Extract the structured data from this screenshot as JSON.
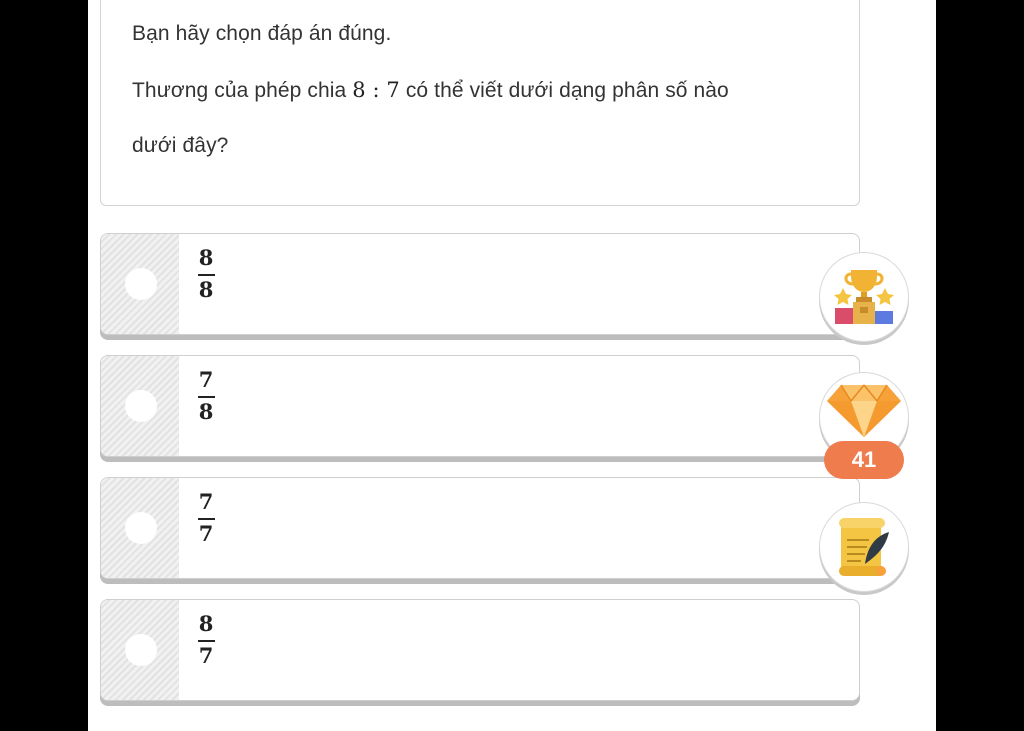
{
  "question": {
    "instruction": "Bạn hãy chọn đáp án đúng.",
    "line1_before": "Thương của phép chia ",
    "expression": "8 : 7",
    "line1_after": " có thể viết dưới dạng phân số nào",
    "line2": "dưới đây?"
  },
  "options": [
    {
      "numerator": "8",
      "denominator": "8"
    },
    {
      "numerator": "7",
      "denominator": "8"
    },
    {
      "numerator": "7",
      "denominator": "7"
    },
    {
      "numerator": "8",
      "denominator": "7"
    }
  ],
  "side_buttons": {
    "leaderboard_icon": "trophy-podium-icon",
    "gems_icon": "diamond-icon",
    "gems_count": "41",
    "notes_icon": "scroll-quill-icon"
  },
  "colors": {
    "badge": "#ef7c4c",
    "diamond": "#f7a13a",
    "trophy": "#f2b233",
    "scroll": "#f4c542"
  }
}
